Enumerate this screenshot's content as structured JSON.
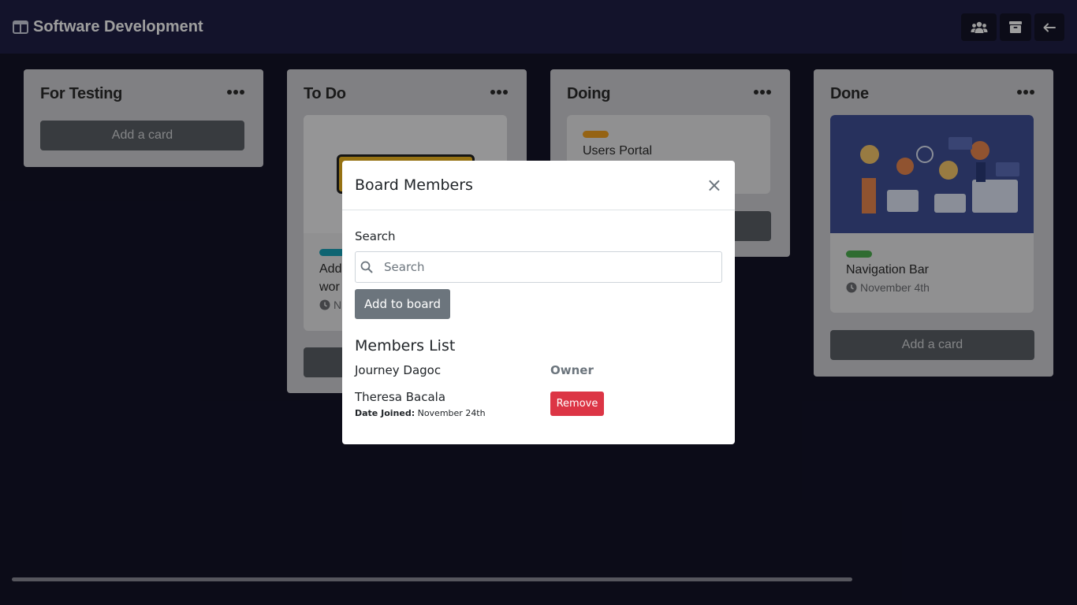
{
  "header": {
    "board_title": "Software Development",
    "icons": [
      "board-icon",
      "members-icon",
      "archive-icon",
      "back-arrow-icon"
    ]
  },
  "lists": [
    {
      "title": "For Testing",
      "add_card_label": "Add a card"
    },
    {
      "title": "To Do",
      "card_title_fragment": "Add",
      "card_title_fragment2": "wor",
      "card_date_fragment": "N",
      "label_color": "#17a2b8"
    },
    {
      "title": "Doing",
      "card_title": "Users Portal",
      "label_color": "#f0a020"
    },
    {
      "title": "Done",
      "card_title": "Navigation Bar",
      "card_date": "November 4th",
      "label_color": "#4caf50",
      "add_card_label": "Add a card"
    }
  ],
  "modal": {
    "title": "Board Members",
    "close_symbol": "×",
    "search_label": "Search",
    "search_placeholder": "Search",
    "search_value": "",
    "add_button": "Add to board",
    "members_heading": "Members List",
    "members": [
      {
        "name": "Journey Dagoc",
        "role": "Owner"
      },
      {
        "name": "Theresa Bacala",
        "date_label": "Date Joined:",
        "date_value": "November 24th",
        "action": "Remove"
      }
    ]
  },
  "colors": {
    "header_bg": "#1f2046",
    "page_bg": "#141428",
    "primary_button": "#6c757d",
    "danger_button": "#dc3545"
  }
}
